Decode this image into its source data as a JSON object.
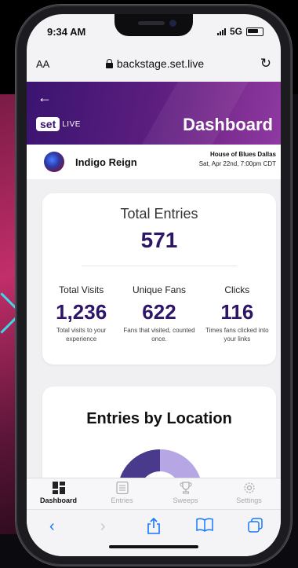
{
  "status_bar": {
    "time": "9:34 AM",
    "network": "5G"
  },
  "browser": {
    "text_size_label": "AA",
    "url": "backstage.set.live"
  },
  "header": {
    "logo_set": "set",
    "logo_live": "LIVE",
    "title": "Dashboard"
  },
  "artist": {
    "name": "Indigo Reign",
    "venue": "House of Blues Dallas",
    "date": "Sat, Apr 22nd, 7:00pm CDT"
  },
  "totals": {
    "label": "Total Entries",
    "value": "571"
  },
  "stats": [
    {
      "label": "Total Visits",
      "value": "1,236",
      "desc": "Total visits to your experience"
    },
    {
      "label": "Unique Fans",
      "value": "622",
      "desc": "Fans that visited, counted once."
    },
    {
      "label": "Clicks",
      "value": "116",
      "desc": "Times fans clicked into your links"
    }
  ],
  "location_card": {
    "title": "Entries by Location"
  },
  "tabs": [
    {
      "label": "Dashboard",
      "icon": "dashboard-icon",
      "active": true
    },
    {
      "label": "Entries",
      "icon": "entries-icon",
      "active": false
    },
    {
      "label": "Sweeps",
      "icon": "trophy-icon",
      "active": false
    },
    {
      "label": "Settings",
      "icon": "gear-icon",
      "active": false
    }
  ],
  "colors": {
    "brand": "#3a1470",
    "accent": "#2d1567",
    "ios_blue": "#1476ff"
  }
}
